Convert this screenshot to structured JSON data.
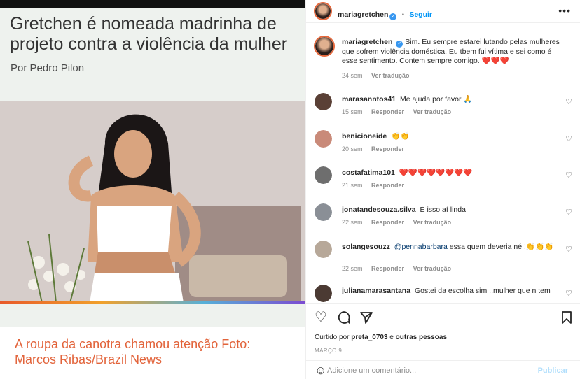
{
  "article": {
    "headline": "Gretchen é nomeada madrinha de projeto contra a violência da mulher",
    "byline": "Por Pedro Pilon",
    "caption": "A roupa da canotra chamou atenção Foto: Marcos Ribas/Brazil News"
  },
  "post": {
    "author": "mariagretchen",
    "follow_label": "Seguir",
    "more_icon": "more-horizontal-icon",
    "caption": {
      "username": "mariagretchen",
      "text": "Sim. Eu sempre estarei lutando pelas mulheres que sofrem violência doméstica. Eu tbem fui vítima e sei como é esse sentimento. Contem sempre comigo. ❤️❤️❤️",
      "time": "24 sem",
      "translate": "Ver tradução"
    },
    "comments": [
      {
        "username": "marasanntos41",
        "text": "Me ajuda por favor 🙏",
        "time": "15 sem",
        "reply": "Responder",
        "translate": "Ver tradução"
      },
      {
        "username": "benicioneide",
        "text": "👏👏",
        "time": "20 sem",
        "reply": "Responder",
        "translate": ""
      },
      {
        "username": "costafatima101",
        "text": "❤️❤️❤️❤️❤️❤️❤️❤️",
        "time": "21 sem",
        "reply": "Responder",
        "translate": ""
      },
      {
        "username": "jonatandesouza.silva",
        "text": "É isso aí linda",
        "time": "22 sem",
        "reply": "Responder",
        "translate": "Ver tradução"
      },
      {
        "username": "solangesouzz",
        "mention": "@pennabarbara",
        "text": "essa quem deveria né !👏👏👏",
        "time": "22 sem",
        "reply": "Responder",
        "translate": "Ver tradução"
      },
      {
        "username": "julianamarasantana",
        "text": "Gostei da escolha sim ..mulher que n tem",
        "time": "",
        "reply": "",
        "translate": ""
      }
    ],
    "liked_by_prefix": "Curtido por",
    "liked_by_user": "preta_0703",
    "liked_by_and": "e",
    "liked_by_others": "outras pessoas",
    "date": "MARÇO 9",
    "comment_placeholder": "Adicione um comentário...",
    "publish_label": "Publicar"
  },
  "colors": {
    "accent_blue": "#0095f6",
    "caption_orange": "#e2633a",
    "muted": "#8e8e8e"
  }
}
